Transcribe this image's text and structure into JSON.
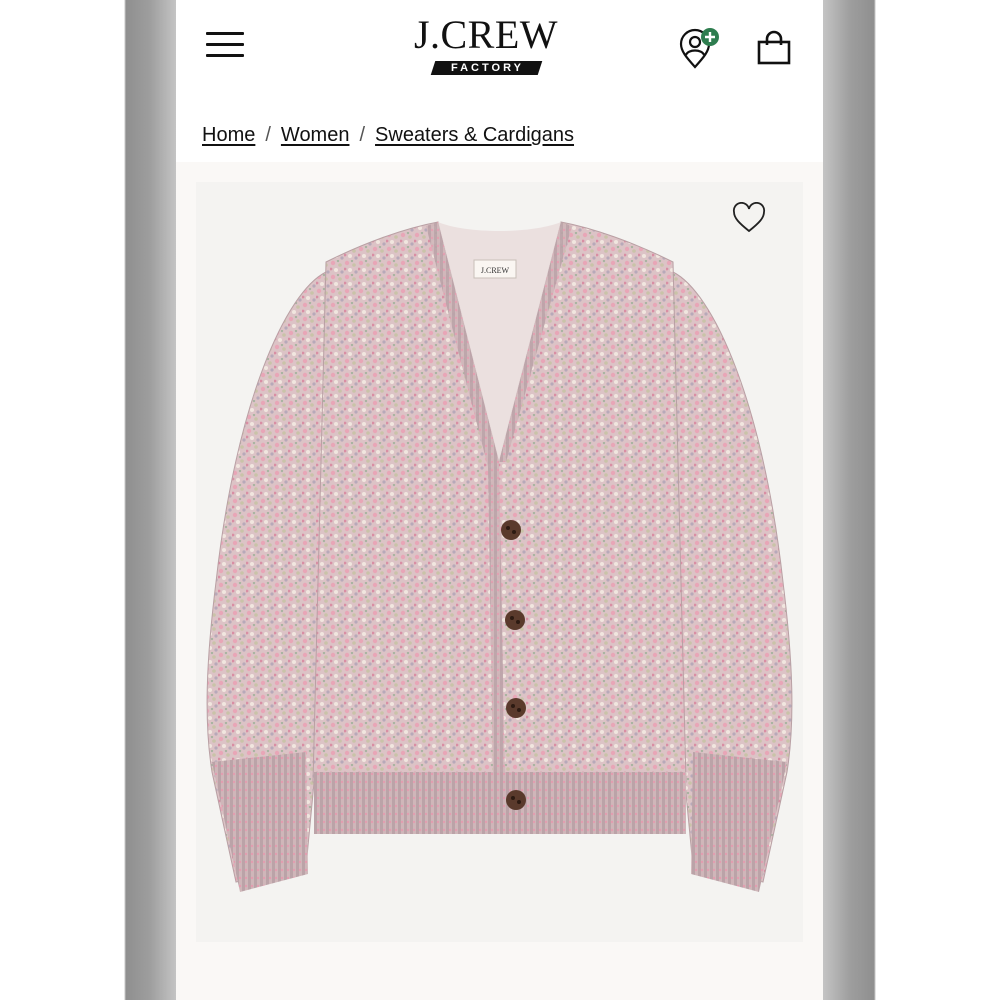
{
  "header": {
    "logo_text": "J.CREW",
    "logo_sub": "FACTORY",
    "menu_icon": "hamburger-menu-icon",
    "account_icon": "account-add-icon",
    "bag_icon": "shopping-bag-icon"
  },
  "breadcrumb": {
    "items": [
      "Home",
      "Women",
      "Sweaters & Cardigans"
    ],
    "separator": "/"
  },
  "product": {
    "image_alt": "Marled V-neck cardigan sweater",
    "garment_label": "J.CREW",
    "wishlist_icon": "heart-outline-icon"
  },
  "colors": {
    "accent_green": "#2e7d4f",
    "sweater_pink": "#d9b9bd",
    "button_brown": "#5a3a2c"
  }
}
